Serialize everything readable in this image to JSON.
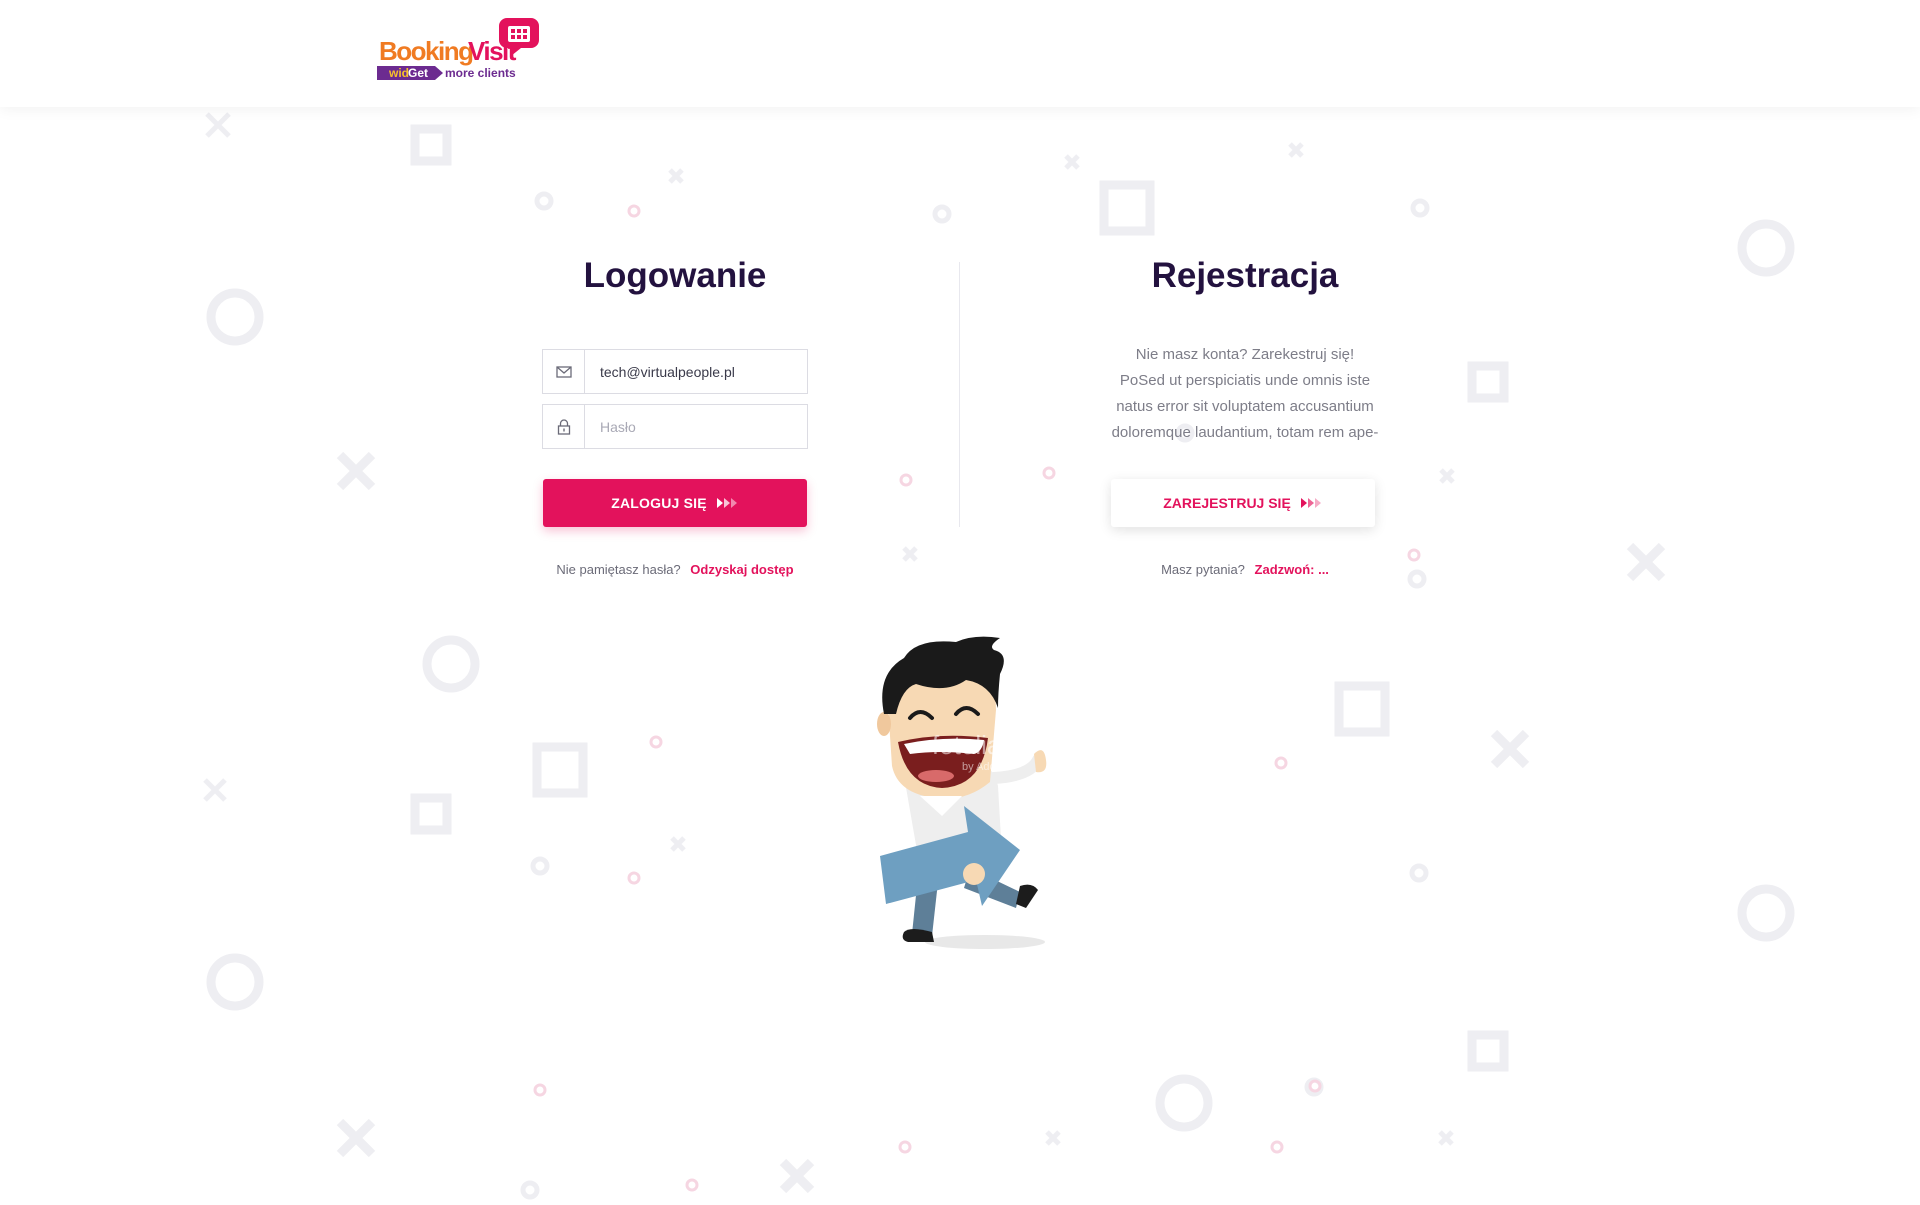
{
  "header": {
    "logo_main": "BookingVisit",
    "logo_tag": "widGet",
    "logo_sub": "more clients"
  },
  "login": {
    "title": "Logowanie",
    "email_value": "tech@virtualpeople.pl",
    "password_placeholder": "Hasło",
    "submit_label": "ZALOGUJ SIĘ",
    "forgot_text": "Nie pamiętasz hasła?",
    "forgot_link": "Odzyskaj dostęp"
  },
  "register": {
    "title": "Rejestracja",
    "lines": [
      "Nie masz konta? Zarekestruj się!",
      "PoSed ut perspiciatis unde omnis iste",
      "natus error sit voluptatem accusantium",
      "doloremque laudantium, totam rem ape-"
    ],
    "submit_label": "ZAREJESTRUJ SIĘ",
    "question_text": "Masz pytania?",
    "call_link": "Zadzwoń: ..."
  },
  "mascot": {
    "watermark": "fotolia",
    "watermark_sub": "by Adobe"
  },
  "colors": {
    "accent": "#e3125c",
    "title": "#23123f",
    "pattern": "#eeeef2",
    "pattern_pink": "#f6c9d8"
  },
  "icons": {
    "email": "envelope-icon",
    "password": "lock-icon",
    "arrows": "fast-forward-icon"
  }
}
